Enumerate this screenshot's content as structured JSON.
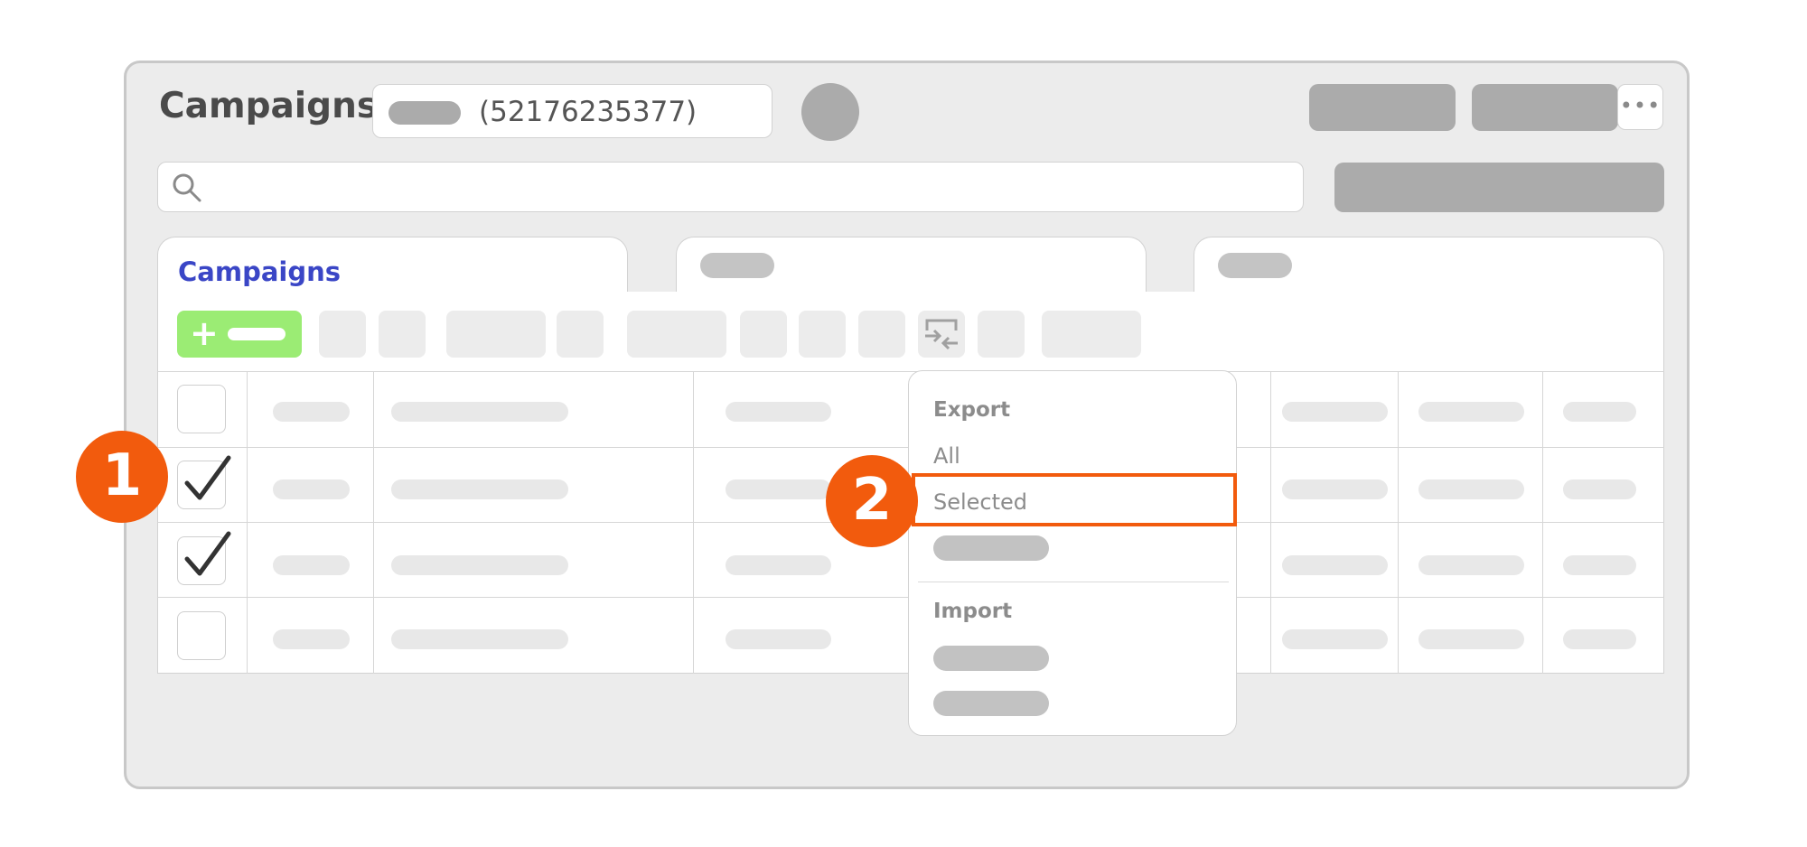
{
  "header": {
    "title": "Campaigns",
    "account_id": "(52176235377)",
    "more_label": "•••"
  },
  "tabs": [
    {
      "label": "Campaigns",
      "active": true
    }
  ],
  "export_menu": {
    "export_heading": "Export",
    "items": [
      "All",
      "Selected"
    ],
    "import_heading": "Import"
  },
  "table": {
    "rows": [
      {
        "checked": false
      },
      {
        "checked": true
      },
      {
        "checked": true
      },
      {
        "checked": false
      }
    ]
  },
  "callouts": [
    "1",
    "2"
  ],
  "colors": {
    "accent": "#f25b0d",
    "active_tab": "#3a46c6",
    "add_button": "#9bec74",
    "placeholder": "#ababab"
  },
  "icons": {
    "search": "search-icon",
    "checkmark": "checkmark-icon",
    "import_export": "import-export-icon",
    "more": "more-icon"
  }
}
